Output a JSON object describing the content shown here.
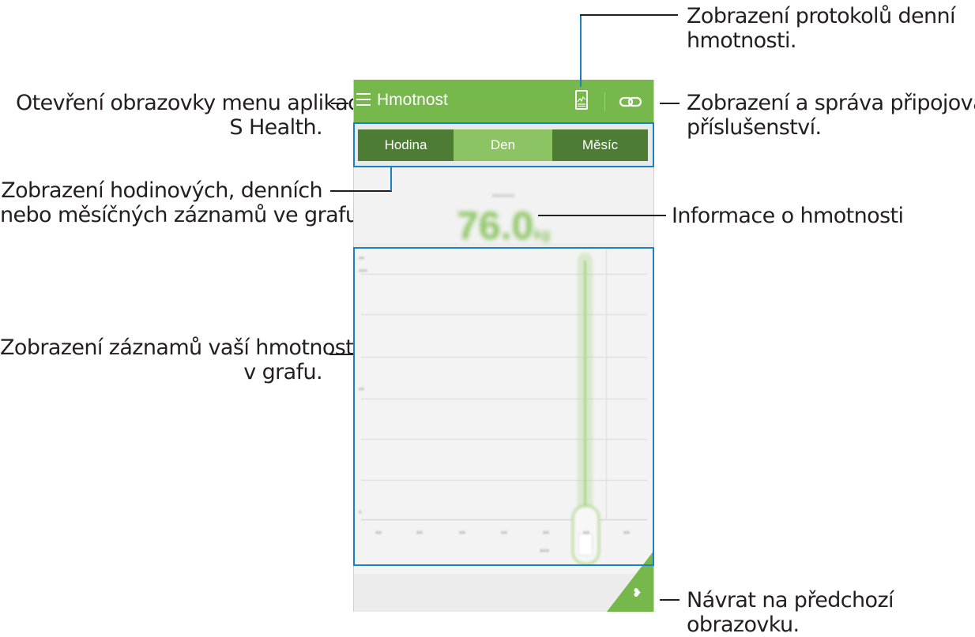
{
  "app": {
    "title": "Hmotnost",
    "tabs": [
      "Hodina",
      "Den",
      "Měsíc"
    ],
    "selected_tab": "Den",
    "weight_value": "76.0",
    "weight_unit": "kg",
    "accent_color": "#77b84d"
  },
  "annotations": {
    "log": "Zobrazení protokolů denní\nhmotnosti.",
    "menu": "Otevření obrazovky menu aplikace\nS Health.",
    "accessory": "Zobrazení a správa připojování\npříslušenství.",
    "tabs": "Zobrazení hodinových, denních\nnebo měsíčných záznamů ve grafu.",
    "info": "Informace o hmotnosti",
    "graph": "Zobrazení záznamů vaší hmotnosti\nv grafu.",
    "back": "Návrat na předchozí obrazovku."
  },
  "icons": {
    "menu": "menu-icon",
    "log": "log-icon",
    "accessory": "link-icon",
    "back": "back-icon"
  }
}
